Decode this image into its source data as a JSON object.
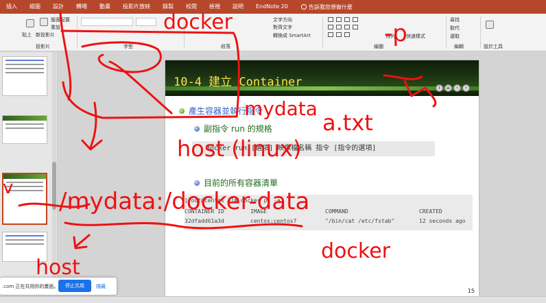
{
  "ribbon_tabs": [
    "插入",
    "繪圖",
    "設計",
    "轉場",
    "動畫",
    "投影片放映",
    "錄製",
    "校閱",
    "檢視",
    "說明",
    "EndNote 20"
  ],
  "tell_me": "告訴我您想做什麼",
  "ribbon": {
    "paste_label": "貼上",
    "new_slide_label": "新投影片",
    "layout_label": "版面配置",
    "reset_label": "重設",
    "slides_group": "投影片",
    "font_group": "字型",
    "paragraph_group": "段落",
    "text_direction": "文字方向",
    "align_text": "對齊文字",
    "convert_smartart": "轉換成 SmartArt",
    "drawing_group": "繪圖",
    "arrange_label": "排列",
    "quick_styles_label": "快速樣式",
    "find_label": "尋找",
    "replace_label": "取代",
    "select_label": "選取",
    "editing_group": "編輯",
    "designer_group": "設計工具"
  },
  "thumbnails": [
    {
      "active": false
    },
    {
      "active": false
    },
    {
      "active": true
    },
    {
      "active": false
    }
  ],
  "slide": {
    "title": "10-4  建立 Container",
    "bullet1": "產生容器並執行指令",
    "bullet2": "副指令 run 的規格",
    "syntax": "docker run [選項] 映像檔名稱 指令 [指令的選項]",
    "bullet3": "目前的所有容器清單",
    "terminal": {
      "prompt": "[root@centos ~]# docker ps -a",
      "headers": [
        "CONTAINER ID",
        "IMAGE",
        "COMMAND",
        "CREATED"
      ],
      "row": [
        "32dfadd61a3d",
        "centos:centos7",
        "\"/bin/cat /etc/fstab\"",
        "12 seconds ago"
      ]
    },
    "page_number": "15"
  },
  "share_bar": {
    "text": ".com 正在共用你的畫面。",
    "stop_label": "停止共用",
    "hide_label": "隱藏"
  },
  "ink": {
    "color": "#ee1111",
    "texts": [
      "docker",
      "-p",
      "mydata",
      "a.txt",
      "host (linux)",
      "/mydata:/docker-data",
      "docker",
      "host",
      "v"
    ]
  }
}
